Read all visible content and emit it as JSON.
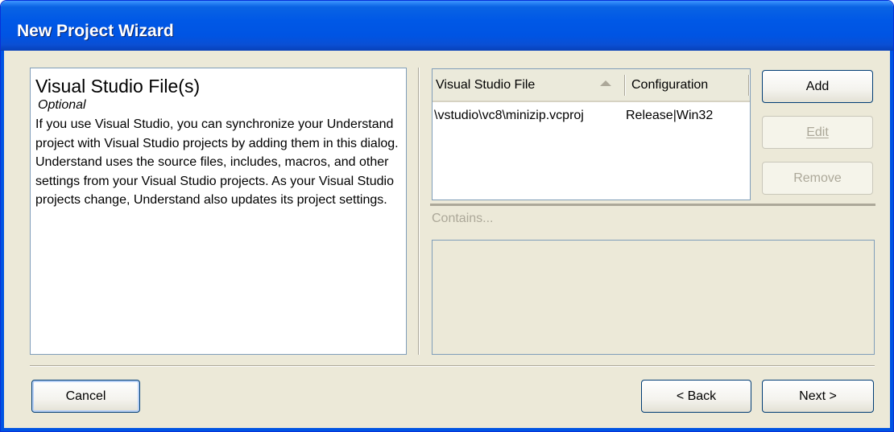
{
  "window": {
    "title": "New Project Wizard"
  },
  "description": {
    "heading": "Visual Studio File(s)",
    "optional": "Optional",
    "body": "If you use Visual Studio, you can synchronize your Understand project with Visual Studio projects by adding them in this dialog. Understand uses the source files, includes, macros, and other settings from your Visual Studio projects. As your Visual Studio projects change, Understand also updates its project settings."
  },
  "file_list": {
    "columns": [
      "Visual Studio File",
      "Configuration"
    ],
    "rows": [
      {
        "file": "\\vstudio\\vc8\\minizip.vcproj",
        "configuration": "Release|Win32"
      }
    ]
  },
  "contains": {
    "label": "Contains..."
  },
  "buttons": {
    "add": "Add",
    "edit": "Edit",
    "remove": "Remove",
    "cancel": "Cancel",
    "back": "< Back",
    "next": "Next >"
  },
  "colors": {
    "titlebar": "#0054e3",
    "dialog_bg": "#ece9d8",
    "disabled_text": "#aca899"
  }
}
